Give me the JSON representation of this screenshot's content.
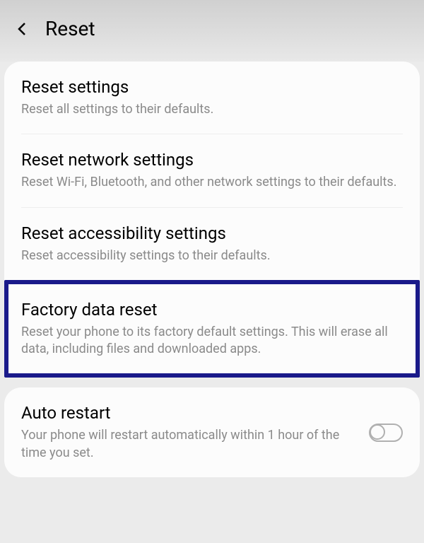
{
  "header": {
    "title": "Reset"
  },
  "items": {
    "reset_settings": {
      "title": "Reset settings",
      "desc": "Reset all settings to their defaults."
    },
    "reset_network": {
      "title": "Reset network settings",
      "desc": "Reset Wi-Fi, Bluetooth, and other network settings to their defaults."
    },
    "reset_accessibility": {
      "title": "Reset accessibility settings",
      "desc": "Reset accessibility settings to their defaults."
    },
    "factory_reset": {
      "title": "Factory data reset",
      "desc": "Reset your phone to its factory default settings. This will erase all data, including files and downloaded apps."
    },
    "auto_restart": {
      "title": "Auto restart",
      "desc": "Your phone will restart automatically within 1 hour of the time you set.",
      "enabled": false
    }
  }
}
